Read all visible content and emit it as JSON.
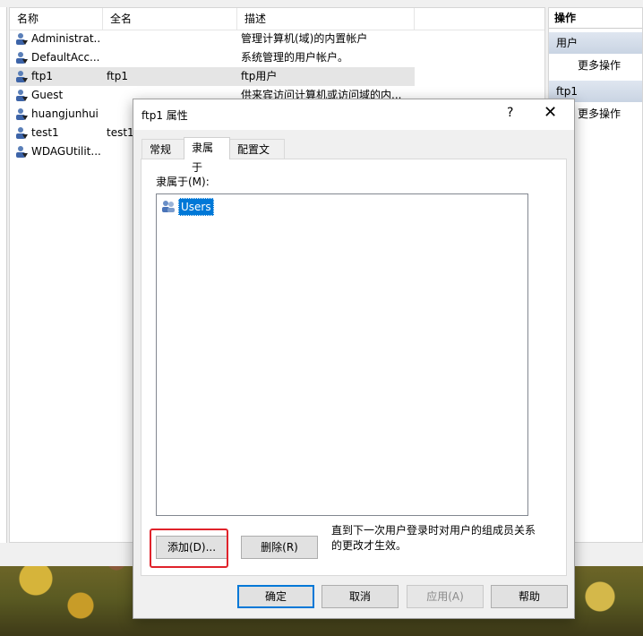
{
  "columns": {
    "name": "名称",
    "fullname": "全名",
    "desc": "描述"
  },
  "users": [
    {
      "name": "Administrat...",
      "fullname": "",
      "desc": "管理计算机(域)的内置帐户"
    },
    {
      "name": "DefaultAcc...",
      "fullname": "",
      "desc": "系统管理的用户帐户。"
    },
    {
      "name": "ftp1",
      "fullname": "ftp1",
      "desc": "ftp用户",
      "selected": true
    },
    {
      "name": "Guest",
      "fullname": "",
      "desc": "供来宾访问计算机或访问域的内..."
    },
    {
      "name": "huangjunhui",
      "fullname": "",
      "desc": ""
    },
    {
      "name": "test1",
      "fullname": "test1",
      "desc": ""
    },
    {
      "name": "WDAGUtilit...",
      "fullname": "",
      "desc": ""
    }
  ],
  "actions": {
    "header": "操作",
    "section1": "用户",
    "item1": "更多操作",
    "section2": "ftp1",
    "item2": "更多操作"
  },
  "dialog": {
    "title": "ftp1 属性",
    "help": "?",
    "close": "✕",
    "tabs": [
      "常规",
      "隶属于",
      "配置文件"
    ],
    "member_label": "隶属于(M):",
    "members": [
      "Users"
    ],
    "add_button": "添加(D)...",
    "remove_button": "删除(R)",
    "note": "直到下一次用户登录时对用户的组成员关系的更改才生效。",
    "ok": "确定",
    "cancel": "取消",
    "apply": "应用(A)",
    "help_button": "帮助"
  },
  "colors": {
    "selection": "#0078d7",
    "highlight": "#e0232b"
  }
}
